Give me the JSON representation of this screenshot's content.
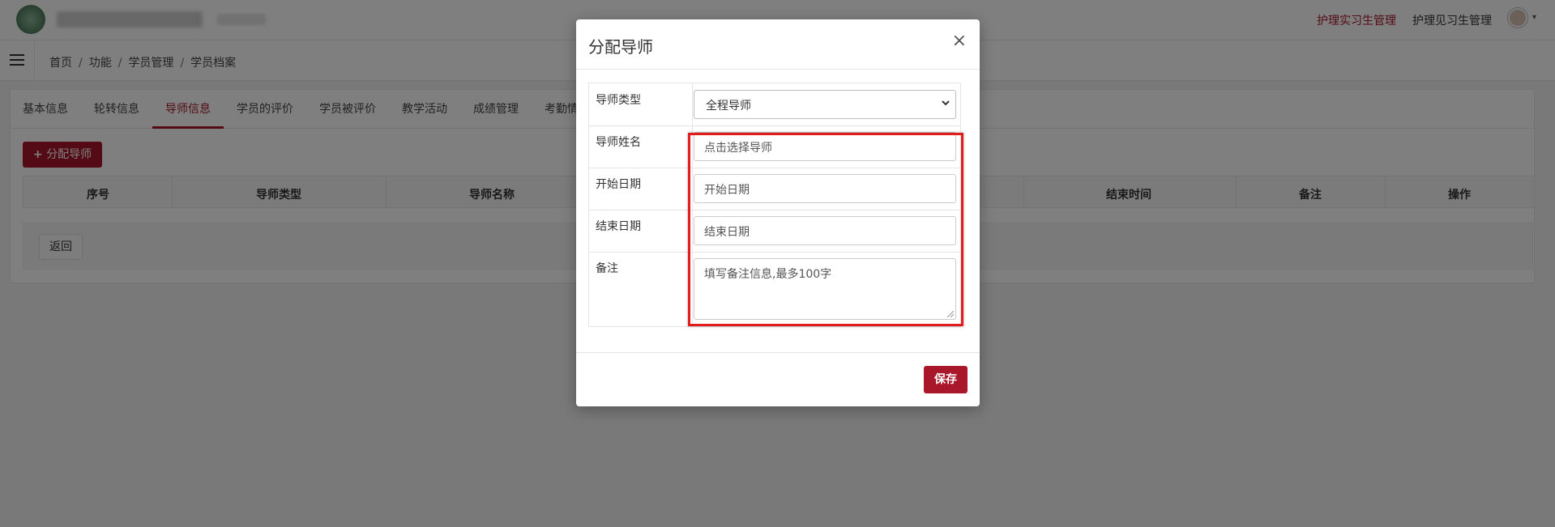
{
  "topbar": {
    "links": [
      {
        "label": "护理实习生管理",
        "active": true
      },
      {
        "label": "护理见习生管理",
        "active": false
      }
    ],
    "caret": "▾"
  },
  "breadcrumb": {
    "items": [
      "首页",
      "功能",
      "学员管理",
      "学员档案"
    ],
    "separator": "/"
  },
  "tabs": [
    {
      "label": "基本信息",
      "active": false
    },
    {
      "label": "轮转信息",
      "active": false
    },
    {
      "label": "导师信息",
      "active": true
    },
    {
      "label": "学员的评价",
      "active": false
    },
    {
      "label": "学员被评价",
      "active": false
    },
    {
      "label": "教学活动",
      "active": false
    },
    {
      "label": "成绩管理",
      "active": false
    },
    {
      "label": "考勤情",
      "active": false
    }
  ],
  "toolbar": {
    "assign_label": "分配导师",
    "plus": "+"
  },
  "table": {
    "headers": [
      "序号",
      "导师类型",
      "导师名称",
      "结束时间",
      "备注",
      "操作"
    ]
  },
  "footer": {
    "back_label": "返回"
  },
  "modal": {
    "title": "分配导师",
    "close": "×",
    "fields": {
      "type_label": "导师类型",
      "type_value": "全程导师",
      "name_label": "导师姓名",
      "name_placeholder": "点击选择导师",
      "start_label": "开始日期",
      "start_placeholder": "开始日期",
      "end_label": "结束日期",
      "end_placeholder": "结束日期",
      "note_label": "备注",
      "note_placeholder": "填写备注信息,最多100字"
    },
    "save_label": "保存"
  },
  "colors": {
    "accent": "#a8172a",
    "highlight": "#e21b1b",
    "overlay": "rgba(0,0,0,0.5)"
  }
}
